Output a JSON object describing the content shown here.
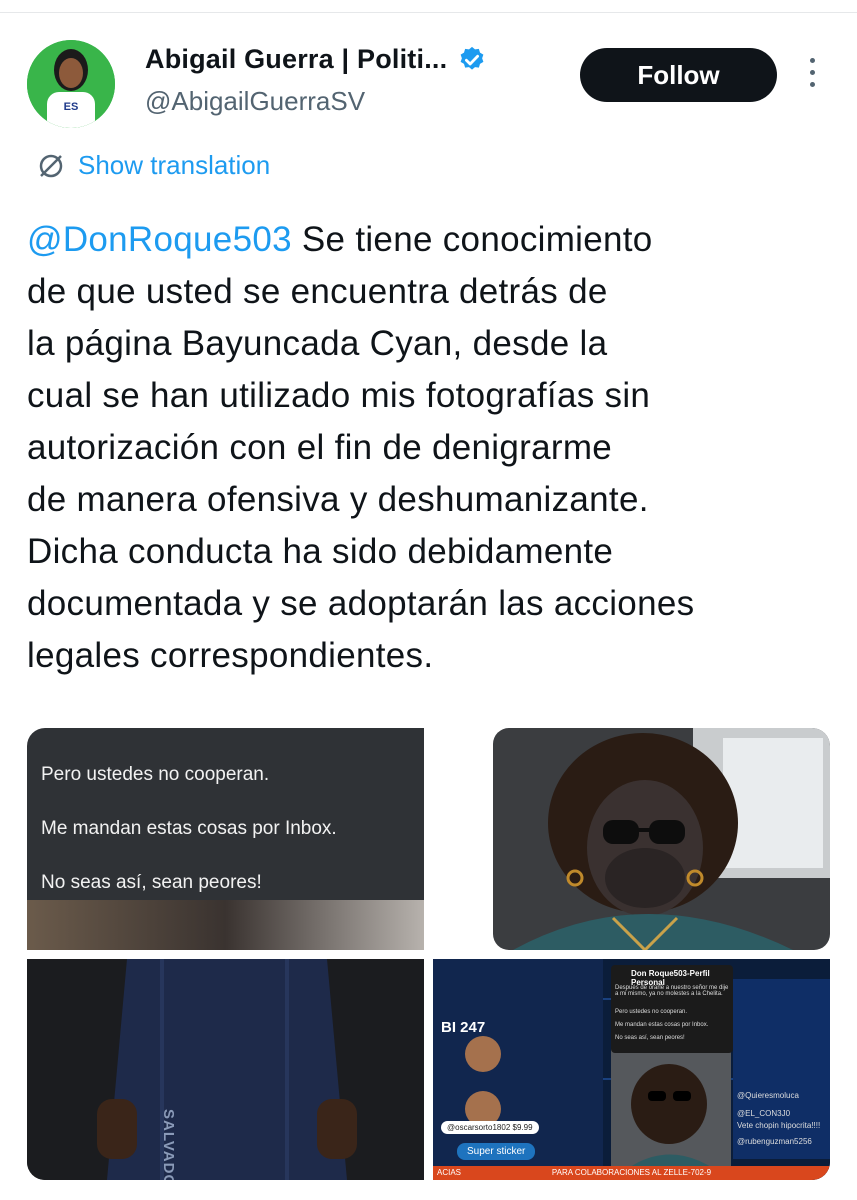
{
  "user": {
    "display_name": "Abigail Guerra | Politi...",
    "handle": "@AbigailGuerraSV",
    "avatar_text": "ES"
  },
  "actions": {
    "follow_label": "Follow",
    "translate_label": "Show translation"
  },
  "tweet": {
    "mention": "@DonRoque503",
    "lines": [
      " Se tiene conocimiento",
      "de que usted se encuentra detrás de",
      "la página Bayuncada Cyan, desde la",
      "cual se han utilizado mis fotografías sin",
      "autorización con el fin de denigrarme",
      "de manera ofensiva y deshumanizante.",
      "Dicha conducta ha sido debidamente",
      "documentada y se adoptarán las acciones",
      "legales correspondientes."
    ]
  },
  "media": {
    "tile1_lines": [
      "Pero ustedes no cooperan.",
      "Me mandan estas cosas por Inbox.",
      "No seas así, sean peores!"
    ],
    "tile3_text": "SALVADOR",
    "tile4": {
      "header": "Don Roque503-Perfil Personal",
      "post_lines": [
        "Después de orarle a nuestro señor me dije a mi mismo, ya no molestes a la Chelita.",
        "Pero ustedes no cooperan.",
        "Me mandan estas cosas por Inbox.",
        "No seas así, sean peores!"
      ],
      "logo": "BI 247",
      "donor": "@oscarsorto1802",
      "amount": "$9.99",
      "super_sticker": "Super sticker",
      "chat": [
        "@Quieresmoluca",
        "@EL_CON3J0",
        "Vete chopin hipocrita!!!!",
        "@rubenguzman5256"
      ],
      "ticker": "PARA COLABORACIONES AL ZELLE-702-9",
      "ticker_left": "ACIAS"
    }
  },
  "colors": {
    "link": "#1d9bf0",
    "text": "#0f1419",
    "muted": "#536471"
  }
}
